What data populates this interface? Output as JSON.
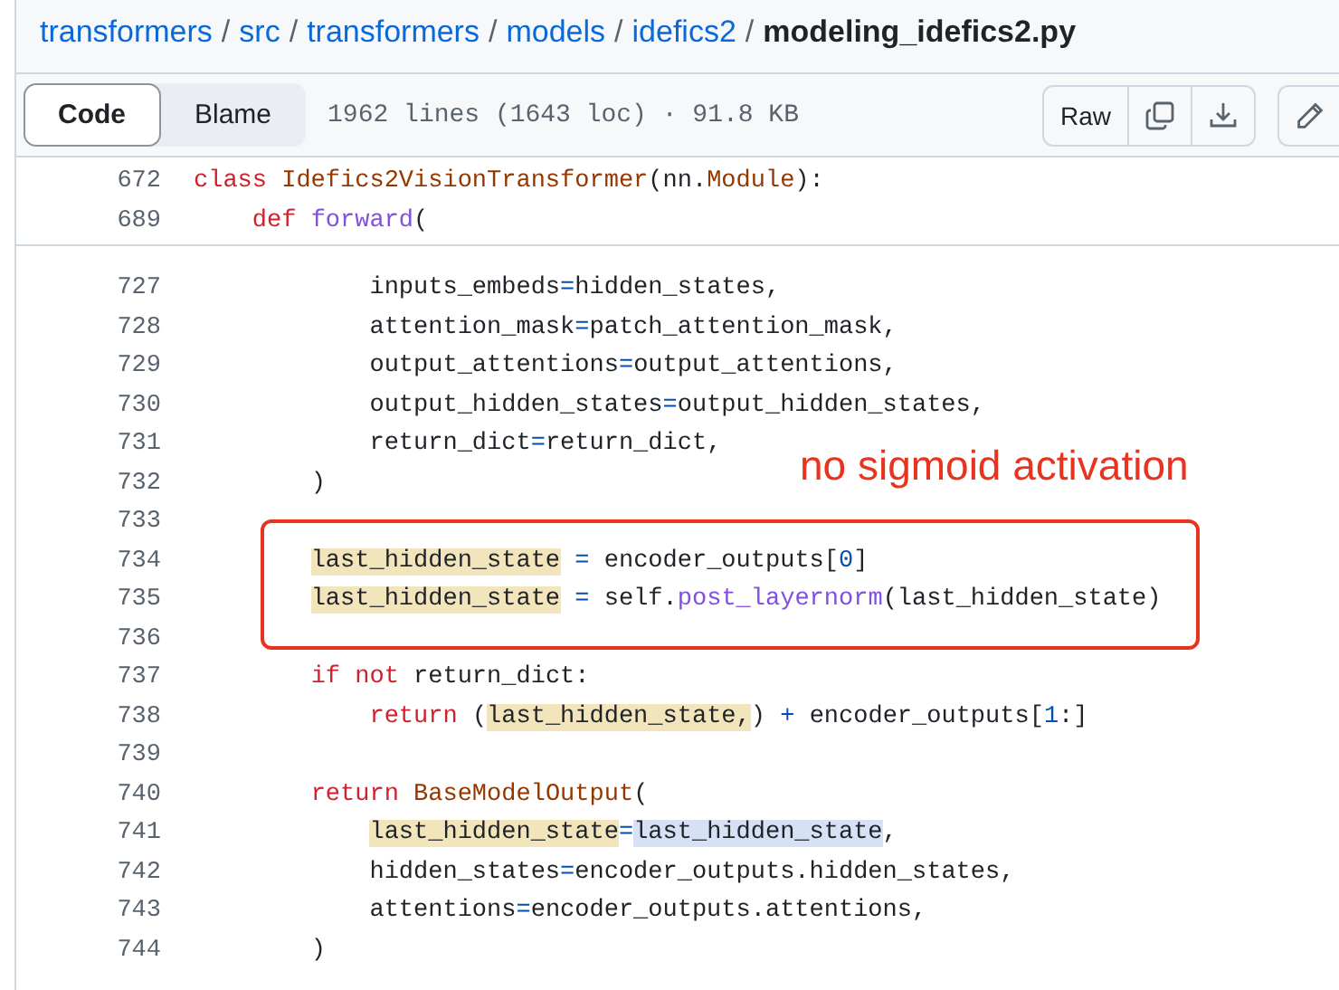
{
  "breadcrumb": {
    "links": [
      "transformers",
      "src",
      "transformers",
      "models",
      "idefics2"
    ],
    "separator": "/",
    "file": "modeling_idefics2.py"
  },
  "toolbar": {
    "tabs": [
      {
        "label": "Code",
        "selected": true
      },
      {
        "label": "Blame",
        "selected": false
      }
    ],
    "file_info": "1962 lines (1643 loc) · 91.8 KB",
    "raw_button": "Raw"
  },
  "sticky_lines": [
    {
      "number": "672",
      "tokens": [
        {
          "kind": "kw",
          "text": "class "
        },
        {
          "kind": "cls",
          "text": "Idefics2VisionTransformer"
        },
        {
          "kind": "plain",
          "text": "(nn."
        },
        {
          "kind": "cls",
          "text": "Module"
        },
        {
          "kind": "plain",
          "text": "):"
        }
      ]
    },
    {
      "number": "689",
      "tokens": [
        {
          "kind": "kw",
          "text": "    def "
        },
        {
          "kind": "fn",
          "text": "forward"
        },
        {
          "kind": "plain",
          "text": "("
        }
      ]
    }
  ],
  "lines": [
    {
      "number": "727",
      "tokens": [
        {
          "kind": "plain",
          "text": "            inputs_embeds"
        },
        {
          "kind": "op",
          "text": "="
        },
        {
          "kind": "plain",
          "text": "hidden_states,"
        }
      ]
    },
    {
      "number": "728",
      "tokens": [
        {
          "kind": "plain",
          "text": "            attention_mask"
        },
        {
          "kind": "op",
          "text": "="
        },
        {
          "kind": "plain",
          "text": "patch_attention_mask,"
        }
      ]
    },
    {
      "number": "729",
      "tokens": [
        {
          "kind": "plain",
          "text": "            output_attentions"
        },
        {
          "kind": "op",
          "text": "="
        },
        {
          "kind": "plain",
          "text": "output_attentions,"
        }
      ]
    },
    {
      "number": "730",
      "tokens": [
        {
          "kind": "plain",
          "text": "            output_hidden_states"
        },
        {
          "kind": "op",
          "text": "="
        },
        {
          "kind": "plain",
          "text": "output_hidden_states,"
        }
      ]
    },
    {
      "number": "731",
      "tokens": [
        {
          "kind": "plain",
          "text": "            return_dict"
        },
        {
          "kind": "op",
          "text": "="
        },
        {
          "kind": "plain",
          "text": "return_dict,"
        }
      ]
    },
    {
      "number": "732",
      "tokens": [
        {
          "kind": "plain",
          "text": "        )"
        }
      ]
    },
    {
      "number": "733"
    },
    {
      "number": "734",
      "tokens": [
        {
          "kind": "plain",
          "text": "        last_hidden_state",
          "highlighted": true
        },
        {
          "kind": "op",
          "text": " ="
        },
        {
          "kind": "plain",
          "text": " encoder_outputs["
        },
        {
          "kind": "num",
          "text": "0"
        },
        {
          "kind": "plain",
          "text": "]"
        }
      ]
    },
    {
      "number": "735",
      "tokens": [
        {
          "kind": "plain",
          "text": "        last_hidden_state",
          "highlighted": true
        },
        {
          "kind": "op",
          "text": " ="
        },
        {
          "kind": "plain",
          "text": " self."
        },
        {
          "kind": "fn",
          "text": "post_layernorm"
        },
        {
          "kind": "plain",
          "text": "(last_hidden_state)"
        }
      ]
    },
    {
      "number": "736"
    },
    {
      "number": "737",
      "tokens": [
        {
          "kind": "kw",
          "text": "        if not"
        },
        {
          "kind": "plain",
          "text": " return_dict:"
        }
      ]
    },
    {
      "number": "738",
      "tokens": [
        {
          "kind": "kw",
          "text": "            return"
        },
        {
          "kind": "plain",
          "text": " ("
        },
        {
          "kind": "plain",
          "text": "last_hidden_state,",
          "highlighted": true
        },
        {
          "kind": "plain",
          "text": ")"
        },
        {
          "kind": "op",
          "text": " +"
        },
        {
          "kind": "plain",
          "text": " encoder_outputs["
        },
        {
          "kind": "num",
          "text": "1"
        },
        {
          "kind": "plain",
          "text": ":]"
        }
      ]
    },
    {
      "number": "739"
    },
    {
      "number": "740",
      "tokens": [
        {
          "kind": "kw",
          "text": "        return "
        },
        {
          "kind": "cls",
          "text": "BaseModelOutput"
        },
        {
          "kind": "plain",
          "text": "("
        }
      ]
    },
    {
      "number": "741",
      "tokens": [
        {
          "kind": "plain",
          "text": "            last_hidden_state",
          "highlighted": true
        },
        {
          "kind": "op",
          "text": "="
        },
        {
          "kind": "plain",
          "text": "last_hidden_state",
          "selected": true
        },
        {
          "kind": "plain",
          "text": ","
        }
      ]
    },
    {
      "number": "742",
      "tokens": [
        {
          "kind": "plain",
          "text": "            hidden_states"
        },
        {
          "kind": "op",
          "text": "="
        },
        {
          "kind": "plain",
          "text": "encoder_outputs.hidden_states,"
        }
      ]
    },
    {
      "number": "743",
      "tokens": [
        {
          "kind": "plain",
          "text": "            attentions"
        },
        {
          "kind": "op",
          "text": "="
        },
        {
          "kind": "plain",
          "text": "encoder_outputs.attentions,"
        }
      ]
    },
    {
      "number": "744",
      "tokens": [
        {
          "kind": "plain",
          "text": "        )"
        }
      ]
    }
  ],
  "annotation": {
    "text": "no sigmoid activation"
  }
}
